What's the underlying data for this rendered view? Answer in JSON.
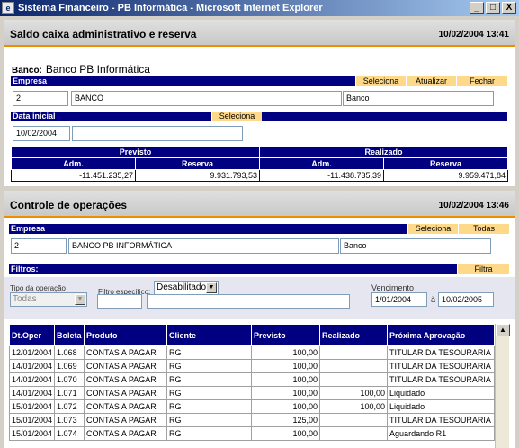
{
  "window": {
    "title": "Sistema Financeiro - PB Informática - Microsoft Internet Explorer",
    "min_label": "_",
    "max_label": "□",
    "close_label": "X"
  },
  "saldo": {
    "title": "Saldo caixa administrativo e reserva",
    "datetime": "10/02/2004 13:41",
    "banco_label": "Banco:",
    "banco_value": "Banco PB Informática",
    "empresa_bar": "Empresa",
    "btn_seleciona": "Seleciona",
    "btn_atualizar": "Atualizar",
    "btn_fechar": "Fechar",
    "empresa_code": "2",
    "empresa_name": "BANCO",
    "empresa_type": "Banco",
    "data_inicial_bar": "Data inicial",
    "data_seleciona": "Seleciona",
    "data_inicial_value": "10/02/2004",
    "previsto": "Previsto",
    "realizado": "Realizado",
    "adm": "Adm.",
    "reserva": "Reserva",
    "prev_adm": "-11.451.235,27",
    "prev_reserva": "9.931.793,53",
    "real_adm": "-11.438.735,39",
    "real_reserva": "9.959.471,84"
  },
  "controle": {
    "title": "Controle de operações",
    "datetime": "10/02/2004 13:46",
    "empresa_bar": "Empresa",
    "btn_seleciona": "Seleciona",
    "btn_todas": "Todas",
    "empresa_code": "2",
    "empresa_name": "BANCO PB INFORMÁTICA",
    "empresa_type": "Banco",
    "filtros_bar": "Filtros:",
    "btn_filtra": "Filtra",
    "tipo_label": "Tipo da operação",
    "tipo_value": "Todas",
    "filtro_label": "Filtro específico:",
    "filtro_value": "Desabilitado",
    "venc_label": "Vencimento",
    "venc_from": "1/01/2004",
    "venc_sep": "à",
    "venc_to": "10/02/2005",
    "columns": [
      "Dt.Oper",
      "Boleta",
      "Produto",
      "Cliente",
      "Previsto",
      "Realizado",
      "Próxima Aprovação"
    ],
    "rows": [
      [
        "12/01/2004",
        "1.068",
        "CONTAS A PAGAR",
        "RG",
        "100,00",
        "",
        "TITULAR DA TESOURARIA"
      ],
      [
        "14/01/2004",
        "1.069",
        "CONTAS A PAGAR",
        "RG",
        "100,00",
        "",
        "TITULAR DA TESOURARIA"
      ],
      [
        "14/01/2004",
        "1.070",
        "CONTAS A PAGAR",
        "RG",
        "100,00",
        "",
        "TITULAR DA TESOURARIA"
      ],
      [
        "14/01/2004",
        "1.071",
        "CONTAS A PAGAR",
        "RG",
        "100,00",
        "100,00",
        "Liquidado"
      ],
      [
        "15/01/2004",
        "1.072",
        "CONTAS A PAGAR",
        "RG",
        "100,00",
        "100,00",
        "Liquidado"
      ],
      [
        "15/01/2004",
        "1.073",
        "CONTAS A PAGAR",
        "RG",
        "125,00",
        "",
        "TITULAR DA TESOURARIA"
      ],
      [
        "15/01/2004",
        "1.074",
        "CONTAS A PAGAR",
        "RG",
        "100,00",
        "",
        "Aguardando R1"
      ]
    ]
  }
}
